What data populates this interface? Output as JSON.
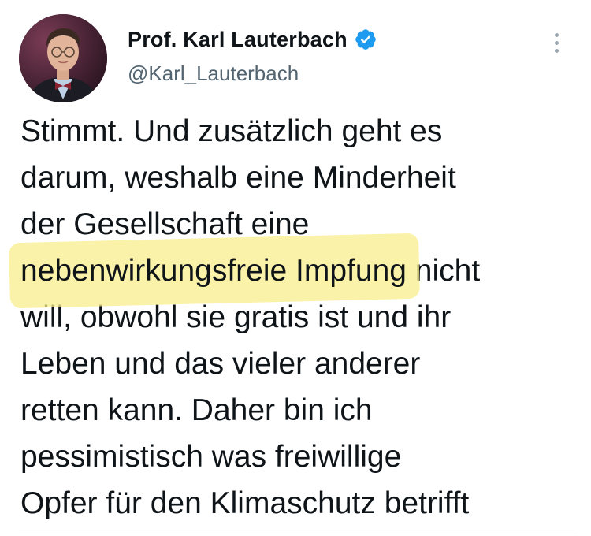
{
  "author": {
    "display_name": "Prof. Karl Lauterbach",
    "handle": "@Karl_Lauterbach",
    "verified": true
  },
  "tweet": {
    "lines": [
      "Stimmt. Und zusätzlich geht es",
      "darum, weshalb eine Minderheit",
      "der Gesellschaft eine",
      "will, obwohl sie gratis ist und ihr",
      "Leben und das vieler anderer",
      "retten kann. Daher bin ich",
      "pessimistisch was freiwillige",
      "Opfer für den Klimaschutz betrifft"
    ],
    "highlighted_phrase": "nebenwirkungsfreie Impfung",
    "line4_rest": " nicht"
  },
  "icons": {
    "verified": "verified-badge-icon",
    "more": "more-options-icon"
  },
  "colors": {
    "verified_blue": "#1d9bf0",
    "highlight_yellow": "#faee8c",
    "text": "#0f1419",
    "secondary_text": "#536471"
  }
}
